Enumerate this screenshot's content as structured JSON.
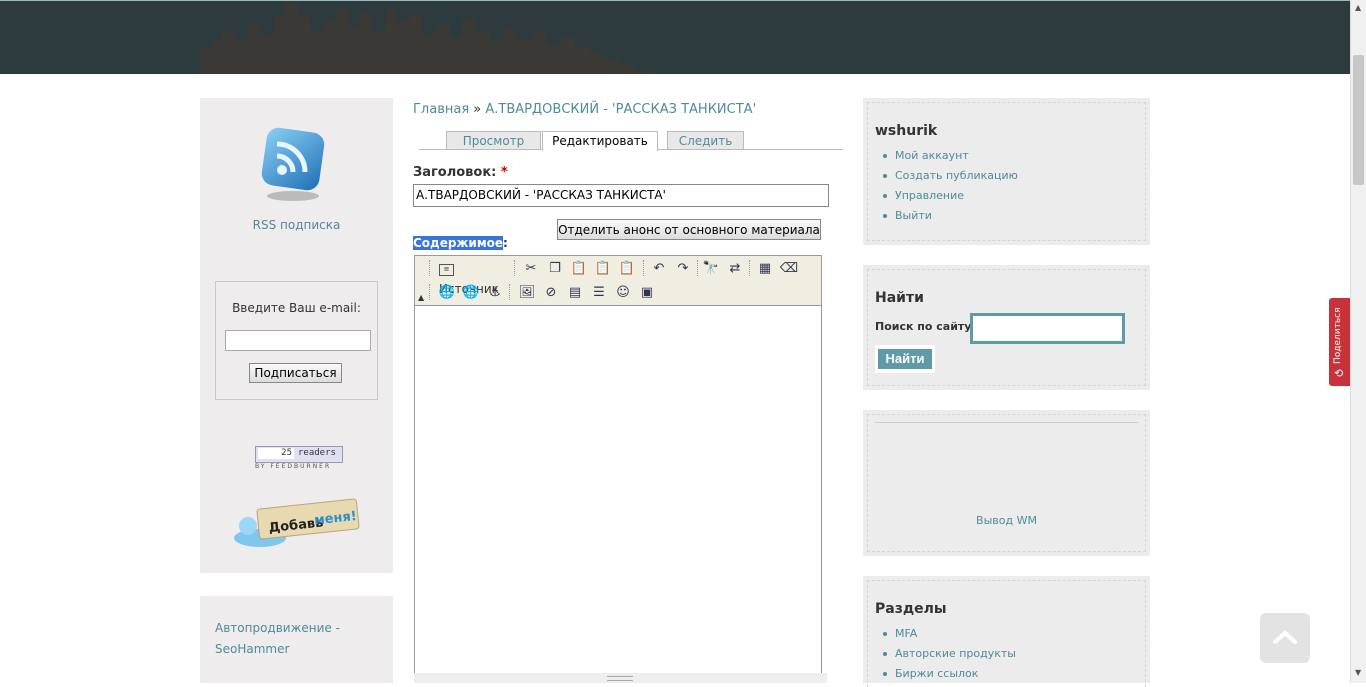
{
  "header": {},
  "left": {
    "rss_text": "RSS подписка",
    "subscribe_label": "Введите Ваш e-mail:",
    "email_value": "",
    "subscribe_button": "Подписаться",
    "feedburner_count": "25",
    "feedburner_readers": "readers",
    "feedburner_by": "BY FEEDBURNER",
    "addme_text_1": "Добавь",
    "addme_text_2": "меня!",
    "autoprod": "Автопродвижение - SeoHammer"
  },
  "breadcrumb": {
    "home": "Главная",
    "separator": "»",
    "current": "А.ТВАРДОВСКИЙ - 'РАССКАЗ ТАНКИСТА'"
  },
  "tabs": [
    {
      "label": "Просмотр"
    },
    {
      "label": "Редактировать"
    },
    {
      "label": "Следить"
    }
  ],
  "form": {
    "title_label": "Заголовок:",
    "required_mark": "*",
    "title_value": "А.ТВАРДОВСКИЙ - 'РАССКАЗ ТАНКИСТА'",
    "split_button": "Отделить анонс от основного материала",
    "content_label": "Содержимое",
    "content_colon": ":",
    "source_button": "Источник"
  },
  "right": {
    "user_title": "wshurik",
    "user_links": [
      "Мой аккаунт",
      "Создать публикацию",
      "Управление",
      "Выйти"
    ],
    "search_title": "Найти",
    "search_label": "Поиск по сайту:",
    "search_value": "",
    "search_button": "Найти",
    "wm_link": "Вывод WM",
    "sections_title": "Разделы",
    "sections": [
      "MFA",
      "Авторские продукты",
      "Биржи ссылок"
    ]
  },
  "share": {
    "label": "Поделиться"
  },
  "colors": {
    "accent": "#4f8a9a",
    "header": "#2d3b3e",
    "share": "#c8323a"
  }
}
